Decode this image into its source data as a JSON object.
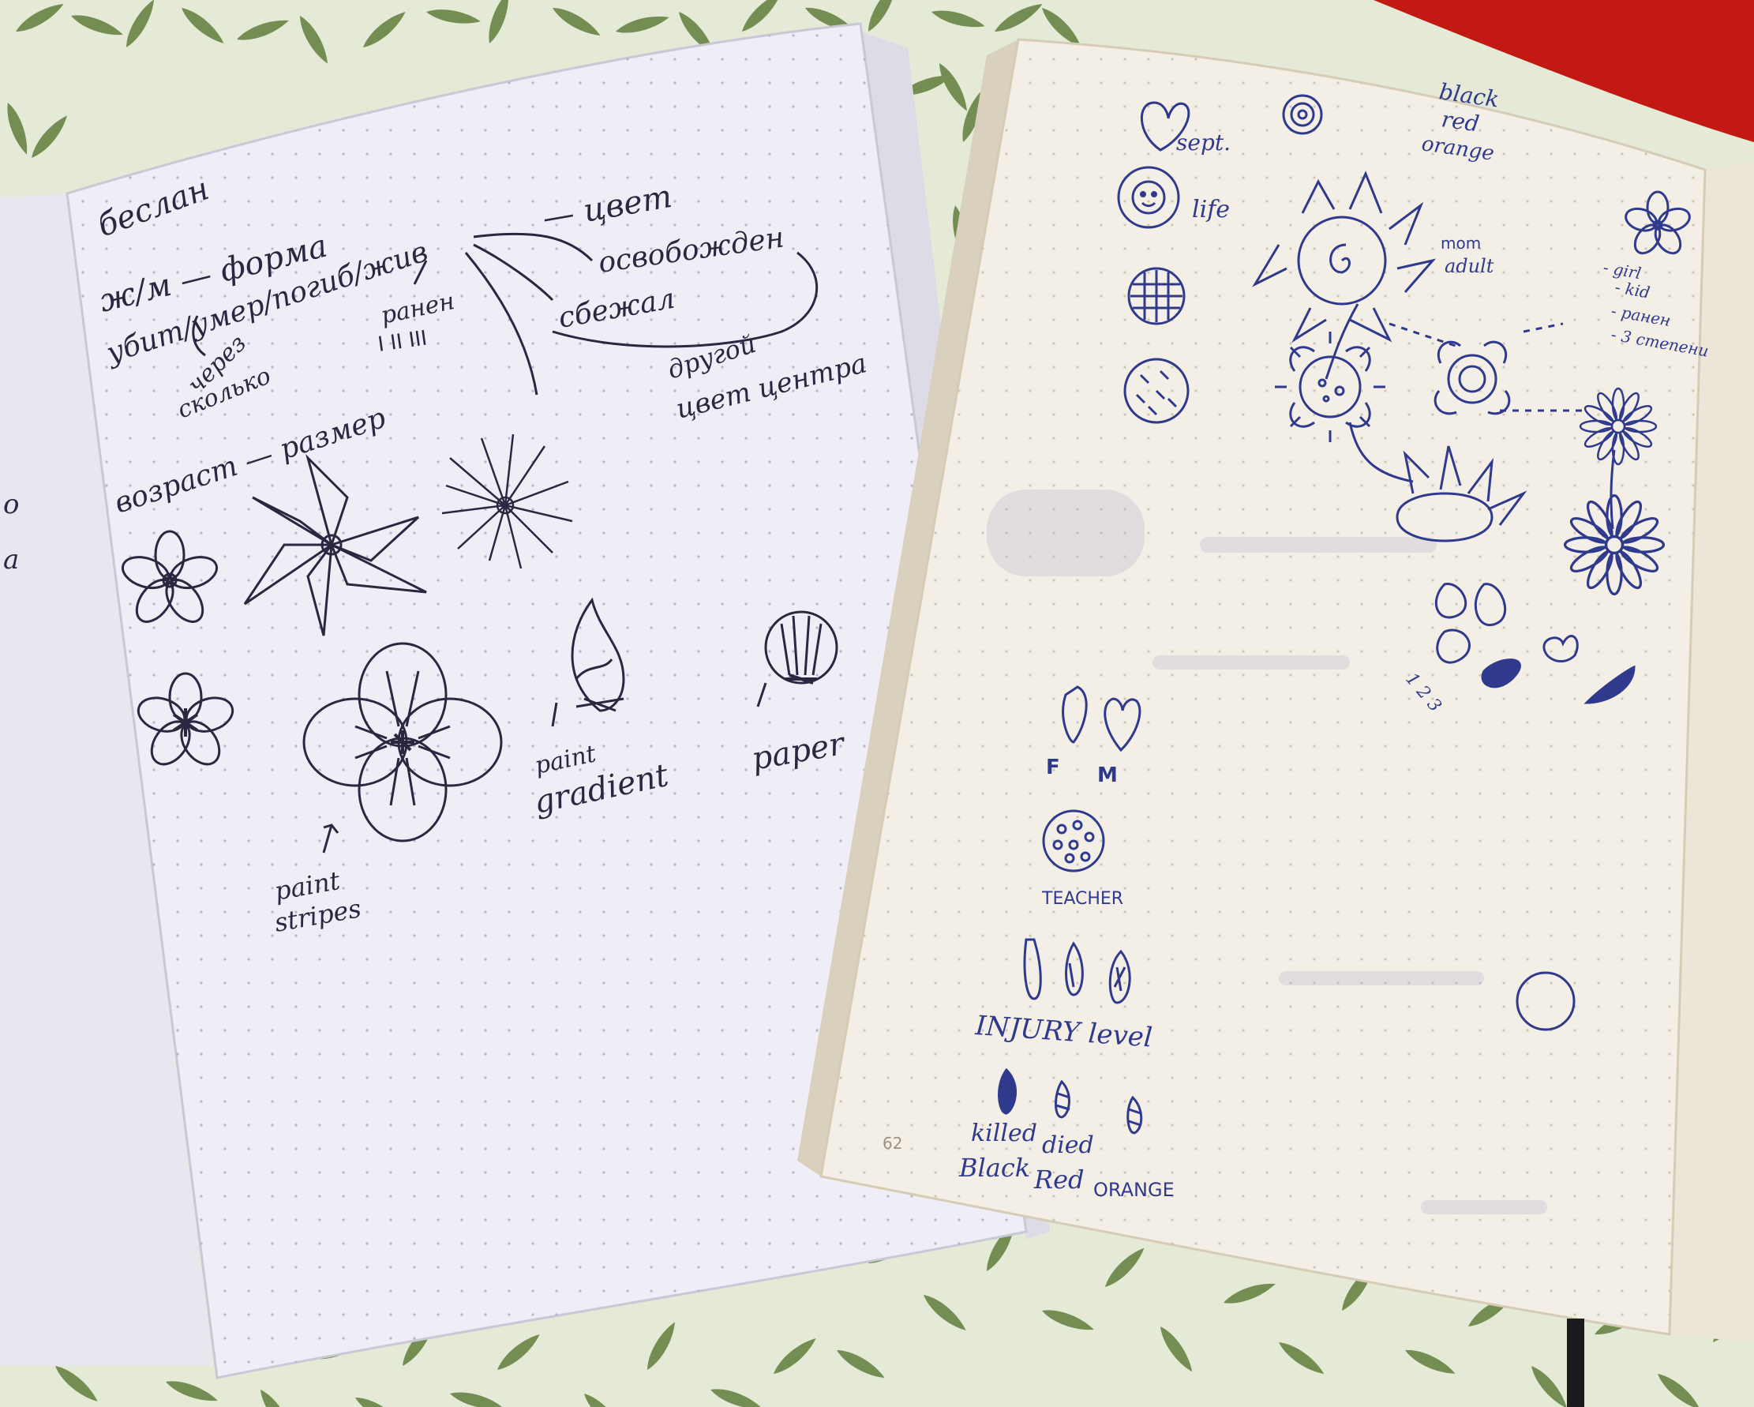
{
  "colors": {
    "fabric": "#e4ead6",
    "leaf": "#5f7d3a",
    "leaf_dark": "#3f5a26",
    "red_accent": "#c21a12",
    "left_page": "#efeef6",
    "right_page": "#f4efe6",
    "ink_black": "#2a2740",
    "ink_blue": "#2f3a8c"
  },
  "left_page": {
    "fragment_o": "о",
    "fragment_a": "а",
    "title": "беслан",
    "line_forma": "ж/м — форма",
    "line_status": "убит/умер/погиб/жив",
    "line_tsvet": "— цвет",
    "free_label": "освобожден",
    "fled_label": "сбежал",
    "arrow_through": "через",
    "arrow_how_many": "сколько",
    "wounded": "ранен",
    "wound_levels": "I  II  III",
    "other_color": "другой",
    "center_label": "цвет центра",
    "age_size": "возраст — размер",
    "caption_stripes_1": "paint",
    "caption_stripes_2": "stripes",
    "caption_gradient_1": "paint",
    "caption_gradient_2": "gradient",
    "caption_paper": "paper"
  },
  "right_page": {
    "label_sept": "sept.",
    "label_life": "life",
    "colors_note_1": "black",
    "colors_note_2": "red",
    "colors_note_3": "orange",
    "mom_1": "mom",
    "mom_2": "adult",
    "girl_1": "- girl",
    "girl_2": "- kid",
    "girl_3": "- ранен",
    "girl_4": "- 3 степени",
    "small_labels": "1  2  3",
    "label_f": "F",
    "label_m": "M",
    "teacher": "TEACHER",
    "injury": "INJURY level",
    "killed": "killed",
    "died": "died",
    "black": "Black",
    "red": "Red",
    "orange": "ORANGE",
    "page_number": "62"
  }
}
